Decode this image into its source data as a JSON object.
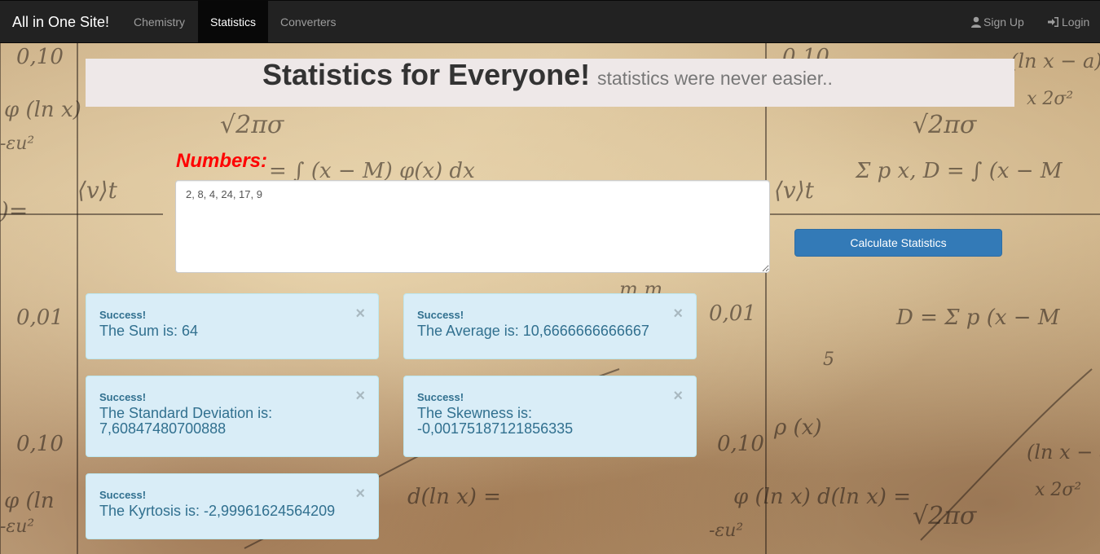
{
  "navbar": {
    "brand": "All in One Site!",
    "links": [
      {
        "label": "Chemistry",
        "active": false
      },
      {
        "label": "Statistics",
        "active": true
      },
      {
        "label": "Converters",
        "active": false
      }
    ],
    "signup_label": "Sign Up",
    "login_label": "Login"
  },
  "header": {
    "title": "Statistics for Everyone!",
    "subtitle": "statistics were never easier.."
  },
  "form": {
    "numbers_label": "Numbers:",
    "numbers_value": "2, 8, 4, 24, 17, 9",
    "calculate_label": "Calculate Statistics"
  },
  "results": [
    {
      "strong": "Success!",
      "text": "The Sum is: 64"
    },
    {
      "strong": "Success!",
      "text": "The Average is: 10,6666666666667"
    },
    {
      "strong": "Success!",
      "text": "The Standard Deviation is: 7,60847480700888"
    },
    {
      "strong": "Success!",
      "text": "The Skewness is: -0,00175187121856335"
    },
    {
      "strong": "Success!",
      "text": "The Kyrtosis is: -2,99961624564209"
    }
  ],
  "close_symbol": "×",
  "colors": {
    "navbar_bg": "#222222",
    "label_red": "#ff0000",
    "button_blue": "#337ab7",
    "alert_bg": "#d9edf7",
    "alert_text": "#31708f"
  }
}
